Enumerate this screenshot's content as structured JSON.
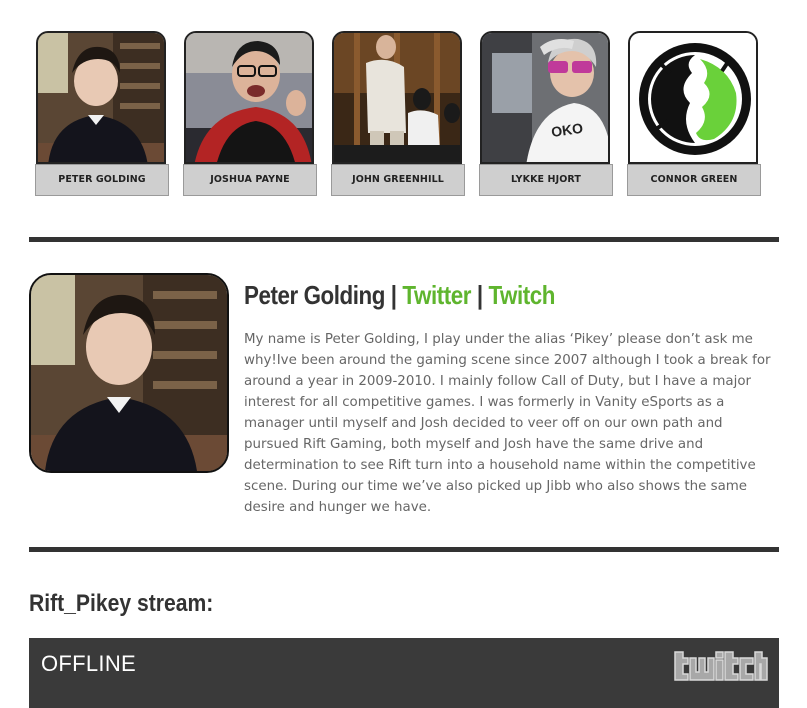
{
  "team": [
    {
      "name": "PETER GOLDING"
    },
    {
      "name": "JOSHUA PAYNE"
    },
    {
      "name": "JOHN GREENHILL"
    },
    {
      "name": "LYKKE HJORT"
    },
    {
      "name": "CONNOR GREEN"
    }
  ],
  "profile": {
    "name": "Peter Golding",
    "separator": "|",
    "twitter_label": "Twitter",
    "twitch_label": "Twitch",
    "bio": "My name is Peter Golding, I play under the alias ‘Pikey’ please don’t ask me why!Ive been around the gaming scene since 2007 although I took a break for around a year in 2009-2010. I mainly follow Call of Duty, but I have a major interest for all competitive games. I was formerly in Vanity eSports as a manager until myself and Josh decided to veer off on our own path and pursued Rift Gaming, both myself and Josh have the same drive and determination to see Rift turn into a household name within the competitive scene. During our time we’ve also picked up Jibb who also shows the same desire and hunger we have."
  },
  "stream": {
    "title": "Rift_Pikey stream:",
    "status": "OFFLINE",
    "logo_icon": "twitch-logo-icon"
  },
  "colors": {
    "accent": "#5fb52e",
    "divider": "#333333",
    "player_bg": "#3a3a3a",
    "name_tab_bg": "#cfcfcf"
  }
}
